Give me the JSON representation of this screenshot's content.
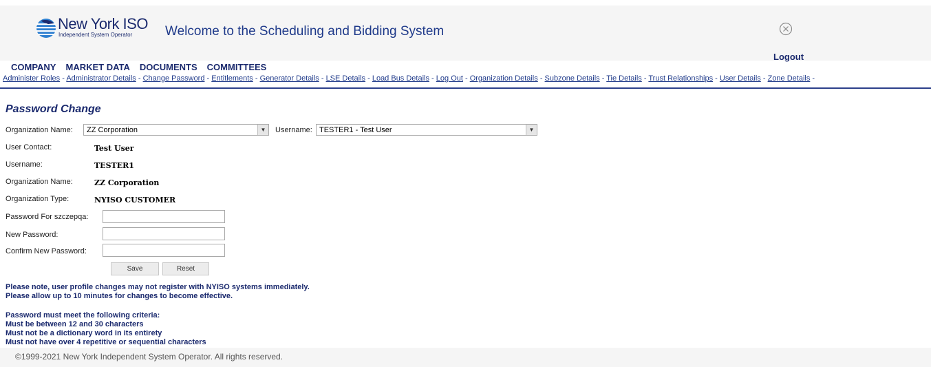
{
  "header": {
    "logo_name": "New York ISO",
    "logo_sub": "Independent System Operator",
    "welcome": "Welcome to the Scheduling and Bidding System",
    "logout": "Logout",
    "close_icon": "close-circle-icon"
  },
  "main_nav": [
    "COMPANY",
    "MARKET DATA",
    "DOCUMENTS",
    "COMMITTEES"
  ],
  "sub_nav": [
    "Administer Roles",
    "Administrator Details",
    "Change Password",
    "Entitlements",
    "Generator Details",
    "LSE Details",
    "Load Bus Details",
    "Log Out",
    "Organization Details",
    "Subzone Details",
    "Tie Details",
    "Trust Relationships",
    "User Details",
    "Zone Details"
  ],
  "sub_nav_separator": " - ",
  "page_title": "Password Change",
  "org_select": {
    "label": "Organization Name:",
    "value": "ZZ Corporation"
  },
  "user_select": {
    "label": "Username:",
    "value": "TESTER1 - Test User"
  },
  "info": {
    "user_contact_label": "User Contact:",
    "user_contact": "Test User",
    "username_label": "Username:",
    "username": "TESTER1",
    "org_name_label": "Organization Name:",
    "org_name": "ZZ Corporation",
    "org_type_label": "Organization Type:",
    "org_type": "NYISO CUSTOMER"
  },
  "password_form": {
    "current_label": "Password For szczepqa:",
    "new_label": "New Password:",
    "confirm_label": "Confirm New Password:",
    "current_value": "",
    "new_value": "",
    "confirm_value": "",
    "save": "Save",
    "reset": "Reset"
  },
  "notes": [
    "Please note, user profile changes may not register with NYISO systems immediately.",
    "Please allow up to 10 minutes for changes to become effective."
  ],
  "criteria": [
    "Password must meet the following criteria:",
    "Must be between 12 and 30 characters",
    "Must not be a dictionary word in its entirety",
    "Must not have over 4 repetitive or sequential characters"
  ],
  "footer": "©1999-2021 New York Independent System Operator. All rights reserved.",
  "colors": {
    "brand": "#1b2a6e",
    "link": "#1f3a8a",
    "rule": "#2b3f8a"
  }
}
